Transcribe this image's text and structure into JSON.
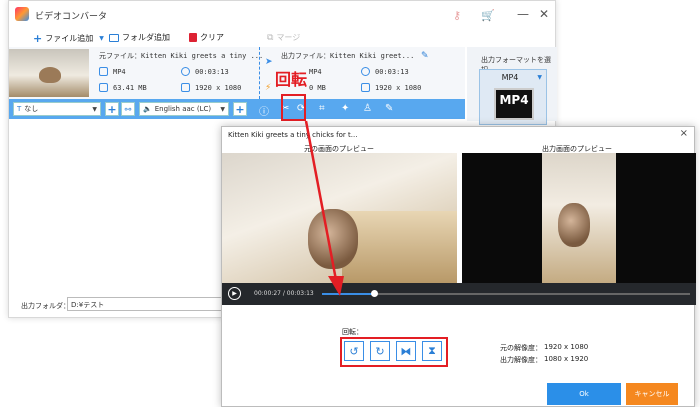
{
  "app": {
    "title": "ビデオコンバータ"
  },
  "toolbar": {
    "add_file": "ファイル追加",
    "add_folder": "フォルダ追加",
    "clear": "クリア",
    "merge": "マージ"
  },
  "file": {
    "source_label": "元ファイル：Kitten Kiki greets a tiny ...",
    "output_label": "出力ファイル：Kitten Kiki greet...",
    "src_format": "MP4",
    "src_duration": "00:03:13",
    "src_size": "63.41 MB",
    "src_resolution": "1920 x 1080",
    "out_format": "MP4",
    "out_duration": "00:03:13",
    "out_size": "0 MB",
    "out_resolution": "1920 x 1080"
  },
  "bar": {
    "subtitle": "なし",
    "audio": "English aac (LC)"
  },
  "annotation": {
    "rotate_label": "回転"
  },
  "right_panel": {
    "select_label": "出力フォーマットを選択",
    "format": "MP4",
    "format_badge": "MP4"
  },
  "output": {
    "folder_label": "出力フォルダ：",
    "folder_value": "D:¥テスト"
  },
  "dialog": {
    "title": "Kitten Kiki greets a tiny chicks for t...",
    "preview_left": "元の画面のプレビュー",
    "preview_right": "出力画面のプレビュー",
    "time": "00:00:27 / 00:03:13",
    "progress": 0.14,
    "rotate_title": "回転：",
    "original_res_label": "元の解像度：",
    "original_res": "1920 x 1080",
    "output_res_label": "出力解像度：",
    "output_res": "1080 x 1920",
    "ok": "Ok",
    "cancel": "キャンセル"
  },
  "colors": {
    "accent": "#3a8ee6",
    "highlight": "#e31e24",
    "cancel": "#f5881f"
  }
}
